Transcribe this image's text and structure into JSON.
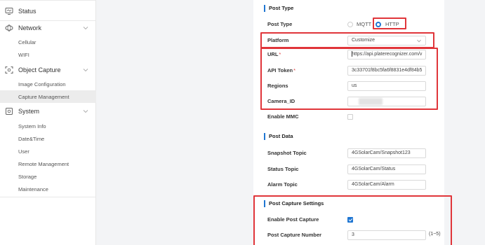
{
  "sidebar": {
    "status": "Status",
    "network": "Network",
    "cellular": "Cellular",
    "wifi": "WIFI",
    "object_capture": "Object Capture",
    "image_configuration": "Image Configuration",
    "capture_management": "Capture Management",
    "system": "System",
    "system_info": "System Info",
    "date_time": "Date&Time",
    "user": "User",
    "remote_management": "Remote Management",
    "storage": "Storage",
    "maintenance": "Maintenance"
  },
  "post_type_section": {
    "title": "Post Type",
    "post_type_label": "Post Type",
    "option_mqtt": "MQTT",
    "option_http": "HTTP",
    "selected": "HTTP",
    "platform_label": "Platform",
    "platform_value": "Customize",
    "url_label": "URL",
    "url_value": "https://api.platerecognizer.com/v",
    "api_token_label": "API Token",
    "api_token_value": "3c33701f8bc5fa6f8831e4df84b5",
    "regions_label": "Regions",
    "regions_value": "us",
    "camera_id_label": "Camera_ID",
    "enable_mmc_label": "Enable MMC",
    "required_mark": "*"
  },
  "post_data_section": {
    "title": "Post Data",
    "snapshot_topic_label": "Snapshot Topic",
    "snapshot_topic_value": "4GSolarCam/Snapshot123",
    "status_topic_label": "Status Topic",
    "status_topic_value": "4GSolarCam/Status",
    "alarm_topic_label": "Alarm Topic",
    "alarm_topic_value": "4GSolarCam/Alarm"
  },
  "post_capture_section": {
    "title": "Post Capture Settings",
    "enable_post_capture_label": "Enable Post Capture",
    "enable_post_capture": true,
    "post_capture_number_label": "Post Capture Number",
    "post_capture_number_value": "3",
    "range_hint": "(1~5)"
  },
  "colors": {
    "accent": "#1f76d2",
    "highlight_box": "#e0353a",
    "required": "#e03c3c",
    "active_nav_bg": "#ececec"
  },
  "icons": {
    "status": "monitor-icon",
    "network": "globe-icon",
    "object_capture": "camera-focus-icon",
    "system": "gear-box-icon"
  }
}
